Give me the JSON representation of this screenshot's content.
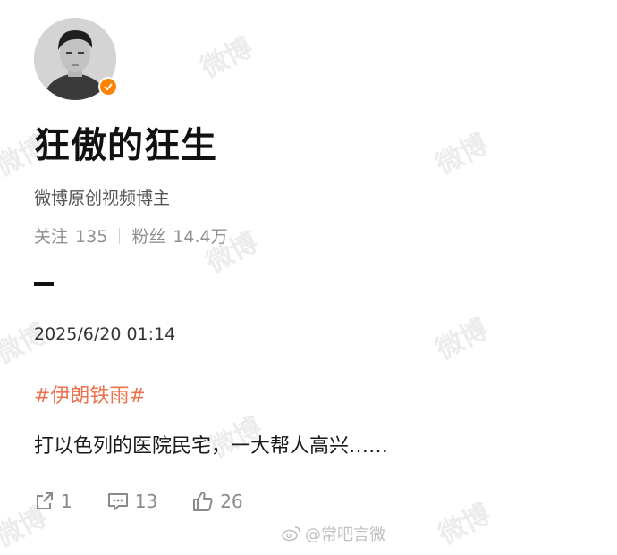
{
  "watermark": {
    "text": "微博"
  },
  "profile": {
    "name": "狂傲的狂生",
    "description": "微博原创视频博主",
    "following_label": "关注",
    "following_count": "135",
    "followers_label": "粉丝",
    "followers_count": "14.4万"
  },
  "post": {
    "timestamp": "2025/6/20 01:14",
    "topic": "#伊朗铁雨#",
    "text": "打以色列的医院民宅，一大帮人高兴……"
  },
  "actions": {
    "share_count": "1",
    "comment_count": "13",
    "like_count": "26"
  },
  "source": {
    "text": "@常吧言微"
  },
  "colors": {
    "verified": "#ff8200",
    "topic": "#eb7350"
  }
}
